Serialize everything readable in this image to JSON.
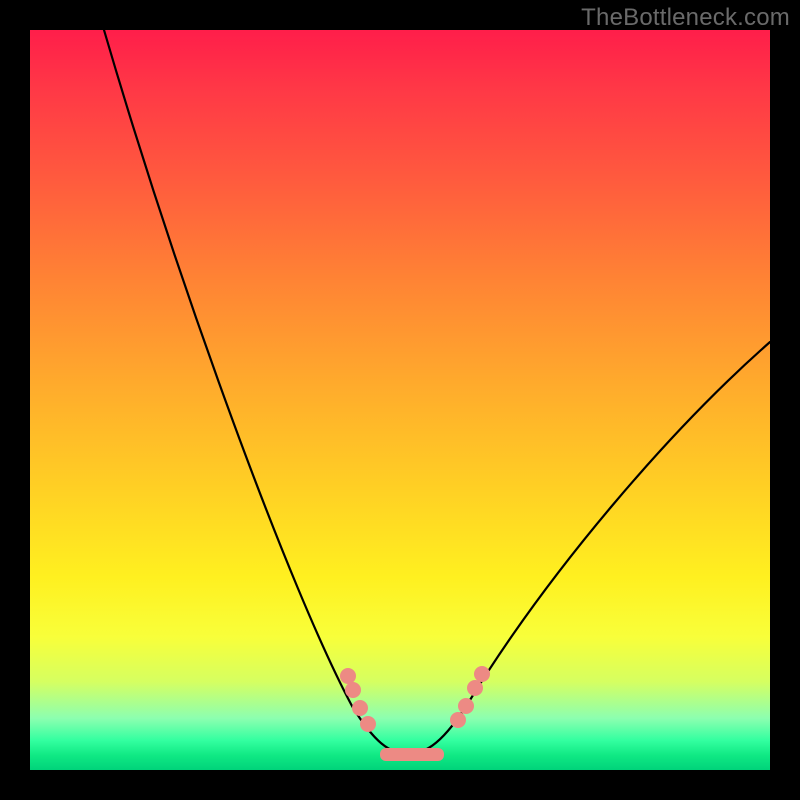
{
  "watermark": "TheBottleneck.com",
  "colors": {
    "frame": "#000000",
    "marker": "#ed8a84",
    "curve": "#000000"
  },
  "chart_data": {
    "type": "line",
    "title": "",
    "xlabel": "",
    "ylabel": "",
    "xlim": [
      0,
      100
    ],
    "ylim": [
      0,
      100
    ],
    "note": "Values are read off a chart with no visible axis ticks; x and y are normalized 0–100 estimates from the plot area.",
    "series": [
      {
        "name": "bottleneck-curve",
        "x": [
          10,
          15,
          20,
          25,
          30,
          35,
          40,
          44,
          48,
          50,
          52,
          55,
          58,
          60,
          65,
          72,
          80,
          90,
          100
        ],
        "y": [
          100,
          85,
          70,
          57,
          44,
          32,
          20,
          10,
          4,
          2,
          2,
          2.8,
          5,
          8,
          15,
          25,
          36,
          48,
          58
        ]
      }
    ],
    "markers": {
      "left_cluster": [
        {
          "x": 43.5,
          "y": 12
        },
        {
          "x": 44.2,
          "y": 10
        },
        {
          "x": 45.2,
          "y": 7.5
        },
        {
          "x": 46,
          "y": 5.5
        }
      ],
      "right_cluster": [
        {
          "x": 58,
          "y": 6.5
        },
        {
          "x": 59,
          "y": 8.5
        },
        {
          "x": 60.2,
          "y": 11
        },
        {
          "x": 61,
          "y": 13
        }
      ],
      "bottom_band": {
        "x_start": 48,
        "x_end": 56,
        "y": 2
      }
    }
  }
}
